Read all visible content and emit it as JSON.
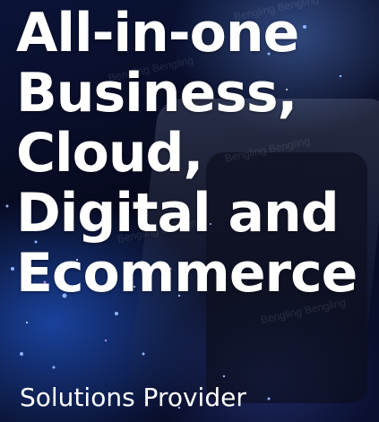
{
  "hero": {
    "headline_lines": [
      "All-in-one",
      "Business,",
      "Cloud,",
      "Digital and",
      "Ecommerce"
    ],
    "subheadline": "Solutions Provider",
    "watermark_text": "Bengling Bengling",
    "text_color": "#ffffff",
    "background_colors": [
      "#05060f",
      "#0b1438",
      "#2a6eff"
    ]
  }
}
